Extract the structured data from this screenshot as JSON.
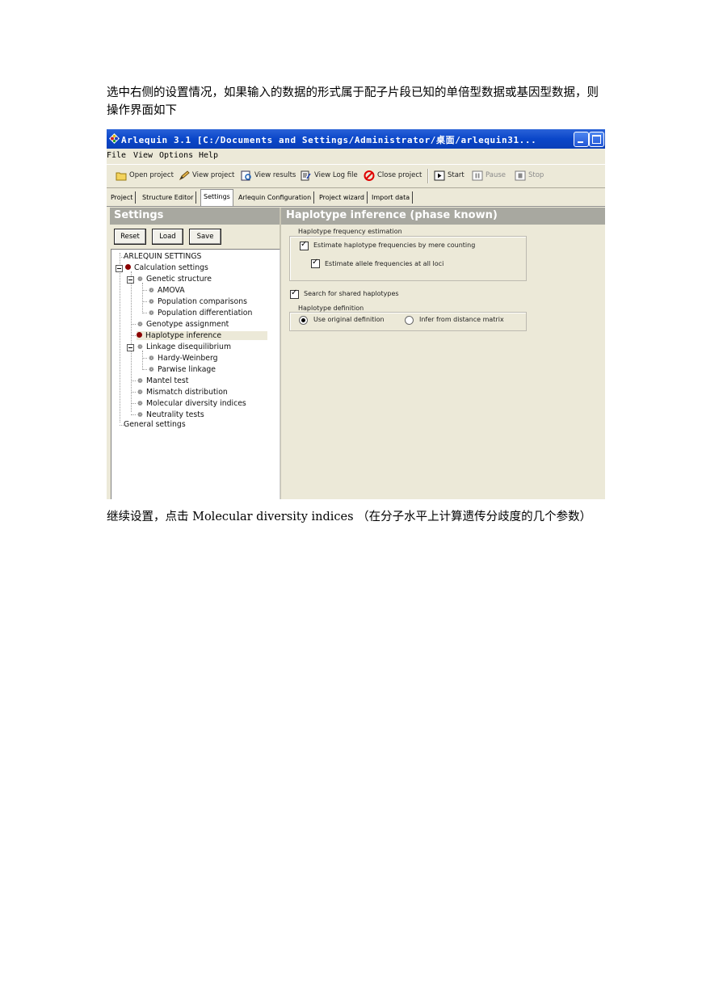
{
  "doc": {
    "paragraph1": "选中右侧的设置情况，如果输入的数据的形式属于配子片段已知的单倍型数据或基因型数据，则操作界面如下",
    "paragraph2": "继续设置，点击 Molecular diversity indices （在分子水平上计算遗传分歧度的几个参数）"
  },
  "window": {
    "title": "Arlequin 3.1 [C:/Documents and Settings/Administrator/桌面/arlequin31..."
  },
  "menu": [
    "File",
    "View",
    "Options",
    "Help"
  ],
  "toolbar": {
    "open_project": "Open project",
    "view_project": "View project",
    "view_results": "View results",
    "view_log": "View Log file",
    "close_project": "Close project",
    "start": "Start",
    "pause": "Pause",
    "stop": "Stop"
  },
  "tabs": [
    "Project",
    "Structure Editor",
    "Settings",
    "Arlequin Configuration",
    "Project wizard",
    "Import data"
  ],
  "left_panel": {
    "header": "Settings",
    "reset": "Reset",
    "load": "Load",
    "save": "Save"
  },
  "tree": {
    "root": "ARLEQUIN SETTINGS",
    "calculation": "Calculation settings",
    "genetic_structure": "Genetic structure",
    "amova": "AMOVA",
    "pop_comparisons": "Population comparisons",
    "pop_differentiation": "Population differentiation",
    "genotype_assignment": "Genotype assignment",
    "haplotype_inference": "Haplotype inference",
    "linkage": "Linkage disequilibrium",
    "hardy_weinberg": "Hardy-Weinberg",
    "pairwise_linkage": "Parwise linkage",
    "mantel": "Mantel test",
    "mismatch": "Mismatch distribution",
    "molecular_diversity": "Molecular diversity indices",
    "neutrality": "Neutrality tests",
    "general": "General settings"
  },
  "right_panel": {
    "header": "Haplotype inference (phase known)",
    "freq_group": "Haplotype frequency estimation",
    "estimate_haplotype": "Estimate haplotype frequencies by mere counting",
    "estimate_haplotype_checked": true,
    "estimate_allele": "Estimate allele frequencies at all loci",
    "estimate_allele_checked": true,
    "search_shared": "Search for shared haplotypes",
    "search_shared_checked": true,
    "def_group": "Haplotype definition",
    "use_original": "Use original definition",
    "infer_distance": "Infer from distance matrix",
    "selected_definition": "Use original definition"
  },
  "colors": {
    "titlebar": "#0a46c9",
    "window_bg": "#ece9d8",
    "panel_header": "#a8a8a0",
    "tree_bullet": "#8b0000"
  }
}
